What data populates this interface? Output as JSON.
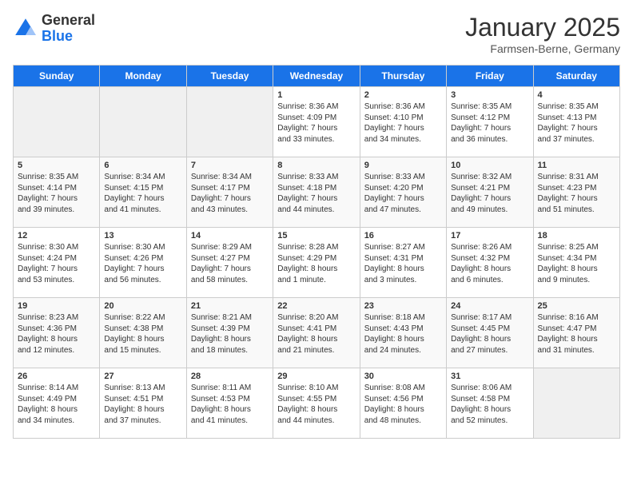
{
  "logo": {
    "general": "General",
    "blue": "Blue"
  },
  "title": "January 2025",
  "location": "Farmsen-Berne, Germany",
  "days_of_week": [
    "Sunday",
    "Monday",
    "Tuesday",
    "Wednesday",
    "Thursday",
    "Friday",
    "Saturday"
  ],
  "weeks": [
    [
      {
        "day": "",
        "content": ""
      },
      {
        "day": "",
        "content": ""
      },
      {
        "day": "",
        "content": ""
      },
      {
        "day": "1",
        "content": "Sunrise: 8:36 AM\nSunset: 4:09 PM\nDaylight: 7 hours\nand 33 minutes."
      },
      {
        "day": "2",
        "content": "Sunrise: 8:36 AM\nSunset: 4:10 PM\nDaylight: 7 hours\nand 34 minutes."
      },
      {
        "day": "3",
        "content": "Sunrise: 8:35 AM\nSunset: 4:12 PM\nDaylight: 7 hours\nand 36 minutes."
      },
      {
        "day": "4",
        "content": "Sunrise: 8:35 AM\nSunset: 4:13 PM\nDaylight: 7 hours\nand 37 minutes."
      }
    ],
    [
      {
        "day": "5",
        "content": "Sunrise: 8:35 AM\nSunset: 4:14 PM\nDaylight: 7 hours\nand 39 minutes."
      },
      {
        "day": "6",
        "content": "Sunrise: 8:34 AM\nSunset: 4:15 PM\nDaylight: 7 hours\nand 41 minutes."
      },
      {
        "day": "7",
        "content": "Sunrise: 8:34 AM\nSunset: 4:17 PM\nDaylight: 7 hours\nand 43 minutes."
      },
      {
        "day": "8",
        "content": "Sunrise: 8:33 AM\nSunset: 4:18 PM\nDaylight: 7 hours\nand 44 minutes."
      },
      {
        "day": "9",
        "content": "Sunrise: 8:33 AM\nSunset: 4:20 PM\nDaylight: 7 hours\nand 47 minutes."
      },
      {
        "day": "10",
        "content": "Sunrise: 8:32 AM\nSunset: 4:21 PM\nDaylight: 7 hours\nand 49 minutes."
      },
      {
        "day": "11",
        "content": "Sunrise: 8:31 AM\nSunset: 4:23 PM\nDaylight: 7 hours\nand 51 minutes."
      }
    ],
    [
      {
        "day": "12",
        "content": "Sunrise: 8:30 AM\nSunset: 4:24 PM\nDaylight: 7 hours\nand 53 minutes."
      },
      {
        "day": "13",
        "content": "Sunrise: 8:30 AM\nSunset: 4:26 PM\nDaylight: 7 hours\nand 56 minutes."
      },
      {
        "day": "14",
        "content": "Sunrise: 8:29 AM\nSunset: 4:27 PM\nDaylight: 7 hours\nand 58 minutes."
      },
      {
        "day": "15",
        "content": "Sunrise: 8:28 AM\nSunset: 4:29 PM\nDaylight: 8 hours\nand 1 minute."
      },
      {
        "day": "16",
        "content": "Sunrise: 8:27 AM\nSunset: 4:31 PM\nDaylight: 8 hours\nand 3 minutes."
      },
      {
        "day": "17",
        "content": "Sunrise: 8:26 AM\nSunset: 4:32 PM\nDaylight: 8 hours\nand 6 minutes."
      },
      {
        "day": "18",
        "content": "Sunrise: 8:25 AM\nSunset: 4:34 PM\nDaylight: 8 hours\nand 9 minutes."
      }
    ],
    [
      {
        "day": "19",
        "content": "Sunrise: 8:23 AM\nSunset: 4:36 PM\nDaylight: 8 hours\nand 12 minutes."
      },
      {
        "day": "20",
        "content": "Sunrise: 8:22 AM\nSunset: 4:38 PM\nDaylight: 8 hours\nand 15 minutes."
      },
      {
        "day": "21",
        "content": "Sunrise: 8:21 AM\nSunset: 4:39 PM\nDaylight: 8 hours\nand 18 minutes."
      },
      {
        "day": "22",
        "content": "Sunrise: 8:20 AM\nSunset: 4:41 PM\nDaylight: 8 hours\nand 21 minutes."
      },
      {
        "day": "23",
        "content": "Sunrise: 8:18 AM\nSunset: 4:43 PM\nDaylight: 8 hours\nand 24 minutes."
      },
      {
        "day": "24",
        "content": "Sunrise: 8:17 AM\nSunset: 4:45 PM\nDaylight: 8 hours\nand 27 minutes."
      },
      {
        "day": "25",
        "content": "Sunrise: 8:16 AM\nSunset: 4:47 PM\nDaylight: 8 hours\nand 31 minutes."
      }
    ],
    [
      {
        "day": "26",
        "content": "Sunrise: 8:14 AM\nSunset: 4:49 PM\nDaylight: 8 hours\nand 34 minutes."
      },
      {
        "day": "27",
        "content": "Sunrise: 8:13 AM\nSunset: 4:51 PM\nDaylight: 8 hours\nand 37 minutes."
      },
      {
        "day": "28",
        "content": "Sunrise: 8:11 AM\nSunset: 4:53 PM\nDaylight: 8 hours\nand 41 minutes."
      },
      {
        "day": "29",
        "content": "Sunrise: 8:10 AM\nSunset: 4:55 PM\nDaylight: 8 hours\nand 44 minutes."
      },
      {
        "day": "30",
        "content": "Sunrise: 8:08 AM\nSunset: 4:56 PM\nDaylight: 8 hours\nand 48 minutes."
      },
      {
        "day": "31",
        "content": "Sunrise: 8:06 AM\nSunset: 4:58 PM\nDaylight: 8 hours\nand 52 minutes."
      },
      {
        "day": "",
        "content": ""
      }
    ]
  ]
}
